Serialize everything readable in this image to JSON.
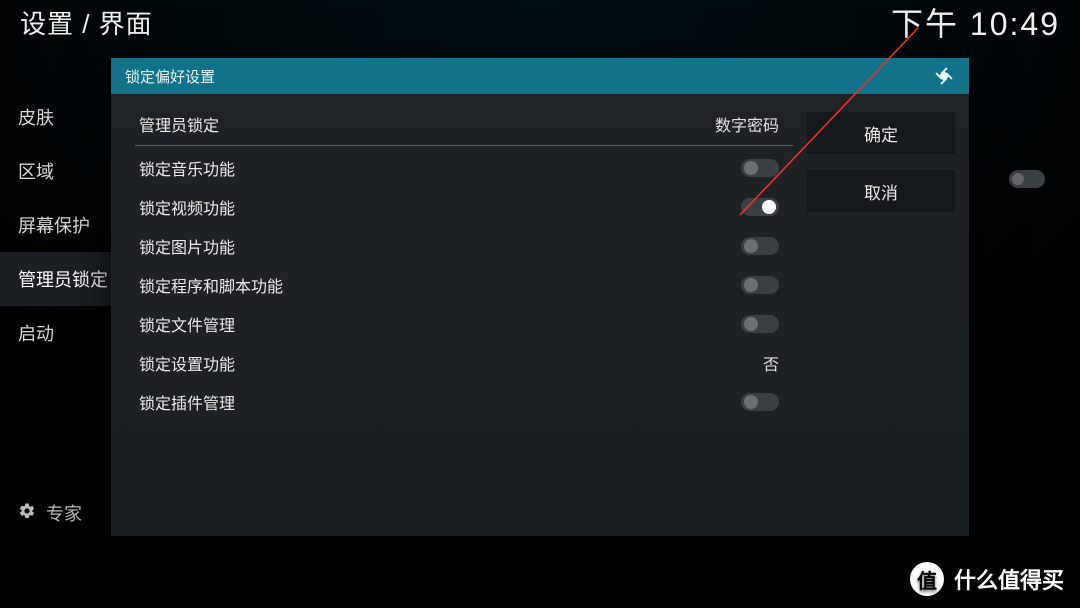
{
  "breadcrumb": "设置 / 界面",
  "clock": "下午 10:49",
  "sidebar": {
    "items": [
      {
        "label": "皮肤"
      },
      {
        "label": "区域"
      },
      {
        "label": "屏幕保护"
      },
      {
        "label": "管理员锁定"
      },
      {
        "label": "启动"
      }
    ]
  },
  "footer": {
    "expert_label": "专家"
  },
  "dialog": {
    "title": "锁定偏好设置",
    "header": {
      "label": "管理员锁定",
      "value": "数字密码"
    },
    "rows": [
      {
        "label": "锁定音乐功能",
        "type": "toggle",
        "on": false
      },
      {
        "label": "锁定视频功能",
        "type": "toggle",
        "on": true
      },
      {
        "label": "锁定图片功能",
        "type": "toggle",
        "on": false
      },
      {
        "label": "锁定程序和脚本功能",
        "type": "toggle",
        "on": false
      },
      {
        "label": "锁定文件管理",
        "type": "toggle",
        "on": false
      },
      {
        "label": "锁定设置功能",
        "type": "value",
        "value": "否"
      },
      {
        "label": "锁定插件管理",
        "type": "toggle",
        "on": false
      }
    ],
    "actions": {
      "ok": "确定",
      "cancel": "取消"
    }
  },
  "watermark": {
    "badge": "值",
    "text": "什么值得买"
  }
}
